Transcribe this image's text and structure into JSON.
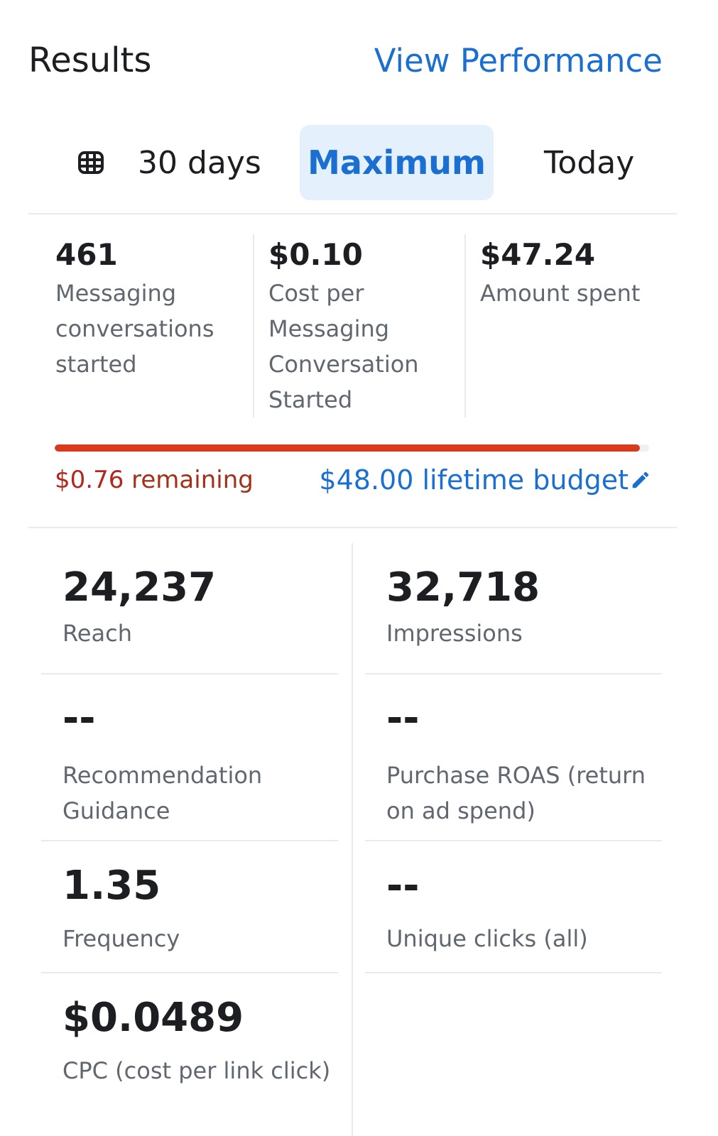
{
  "header": {
    "title": "Results",
    "view_performance": "View Performance"
  },
  "filters": {
    "calendar_icon": "calendar-icon",
    "last_30_days": "30 days",
    "maximum": "Maximum",
    "today": "Today",
    "active_color": "#1a6fd1",
    "active_bg": "#e5f0fd"
  },
  "summary": [
    {
      "value": "461",
      "label_lines": [
        "Messaging",
        "conversations",
        "started"
      ]
    },
    {
      "value": "$0.10",
      "label_lines": [
        "Cost per",
        "Messaging",
        "Conversation",
        "Started"
      ]
    },
    {
      "value": "$47.24",
      "label_lines": [
        "Amount spent"
      ]
    }
  ],
  "budget": {
    "remaining_amount": "$0.76",
    "remaining_text": " remaining",
    "lifetime": "$48.00 lifetime budget",
    "spent_fraction": 0.984,
    "bar_color": "#d83a1d",
    "edit_icon": "pencil-icon"
  },
  "metrics": {
    "reach": {
      "value": "24,237",
      "label": "Reach"
    },
    "impressions": {
      "value": "32,718",
      "label": "Impressions"
    },
    "recommendation": {
      "value": "--",
      "label_line1": "Recommendation",
      "label_line2": "Guidance"
    },
    "roas": {
      "value": "--",
      "label_line1": "Purchase ROAS (return",
      "label_line2": "on ad spend)"
    },
    "frequency": {
      "value": "1.35",
      "label": "Frequency"
    },
    "unique_clicks": {
      "value": "--",
      "label": "Unique clicks (all)"
    },
    "cpc": {
      "value": "$0.0489",
      "label": "CPC (cost per link click)"
    }
  }
}
